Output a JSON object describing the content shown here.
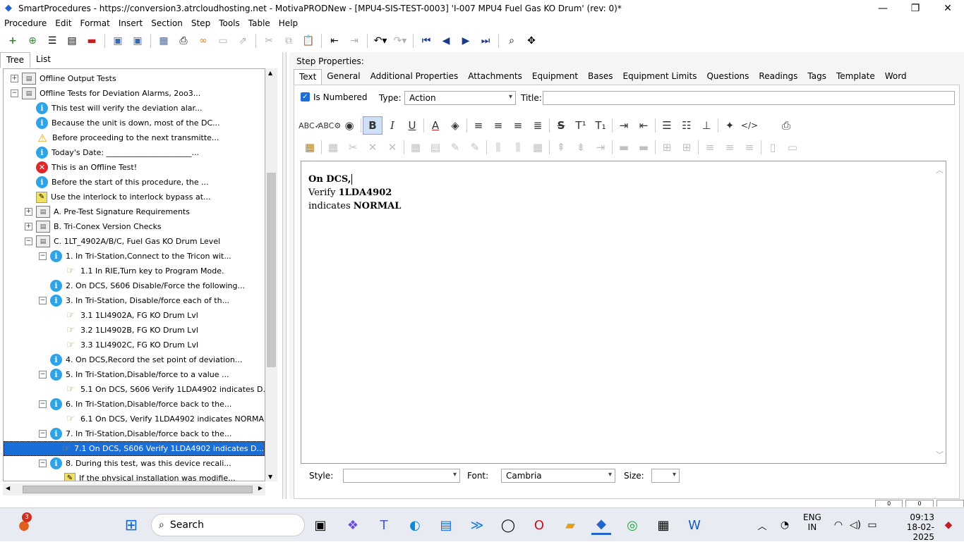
{
  "window": {
    "title": "SmartProcedures - https://conversion3.atrcloudhosting.net - MotivaPRODNew - [MPU4-SIS-TEST-0003] 'I-007 MPU4 Fuel Gas KO Drum' (rev: 0)*",
    "minimize": "—",
    "maximize": "❐",
    "close": "✕"
  },
  "menu": [
    "Procedure",
    "Edit",
    "Format",
    "Insert",
    "Section",
    "Step",
    "Tools",
    "Table",
    "Help"
  ],
  "left_tabs": [
    "Tree",
    "List"
  ],
  "tree": [
    {
      "label": "Offline Output Tests",
      "icon": "folder",
      "expander": "+"
    },
    {
      "label": "Offline Tests for Deviation Alarms, 2oo3...",
      "icon": "folder",
      "expander": "−"
    },
    {
      "label": "This test will verify the deviation alar...",
      "icon": "info"
    },
    {
      "label": "Because the unit is down, most of the DC...",
      "icon": "info"
    },
    {
      "label": "Before proceeding to the next transmitte...",
      "icon": "warning"
    },
    {
      "label": "Today's Date: ______________________...",
      "icon": "info"
    },
    {
      "label": "This is an Offline Test!",
      "icon": "error"
    },
    {
      "label": "Before the start of this procedure, the ...",
      "icon": "info"
    },
    {
      "label": "Use the interlock to interlock bypass at...",
      "icon": "note"
    },
    {
      "label": "A. Pre-Test Signature Requirements",
      "icon": "folder",
      "expander": "+"
    },
    {
      "label": "B. Tri-Conex Version Checks",
      "icon": "folder",
      "expander": "+"
    },
    {
      "label": "C. 1LT_4902A/B/C, Fuel Gas KO Drum Level",
      "icon": "folder",
      "expander": "−"
    },
    {
      "label": "1. In Tri-Station,Connect to the Tricon wit...",
      "icon": "info",
      "expander": "−"
    },
    {
      "label": "1.1 In RIE,Turn key to Program Mode.",
      "icon": "hand"
    },
    {
      "label": "2. On DCS, S606 Disable/Force the following...",
      "icon": "info"
    },
    {
      "label": "3. In Tri-Station, Disable/force each of th...",
      "icon": "info",
      "expander": "−"
    },
    {
      "label": "3.1 1LI4902A, FG KO Drum Lvl",
      "icon": "hand"
    },
    {
      "label": "3.2 1LI4902B, FG KO Drum Lvl",
      "icon": "hand"
    },
    {
      "label": "3.3 1LI4902C, FG KO Drum Lvl",
      "icon": "hand"
    },
    {
      "label": "4. On DCS,Record the set point of deviation...",
      "icon": "info"
    },
    {
      "label": "5. In Tri-Station,Disable/force to a value ...",
      "icon": "info",
      "expander": "−"
    },
    {
      "label": "5.1 On DCS, S606 Verify 1LDA4902 indicates D...",
      "icon": "hand"
    },
    {
      "label": "6. In Tri-Station,Disable/force back to the...",
      "icon": "info",
      "expander": "−"
    },
    {
      "label": "6.1 On DCS, Verify 1LDA4902  indicates NORMA...",
      "icon": "hand"
    },
    {
      "label": "7. In Tri-Station,Disable/force back to the...",
      "icon": "info",
      "expander": "−"
    },
    {
      "label": "7.1 On DCS, S606 Verify 1LDA4902 indicates D...",
      "icon": "hand",
      "selected": true
    },
    {
      "label": "8. During this test, was this device recali...",
      "icon": "info",
      "expander": "−"
    },
    {
      "label": "If the physical installation was modifie...",
      "icon": "note"
    }
  ],
  "step_properties": {
    "label": "Step Properties:",
    "tabs": [
      "Text",
      "General",
      "Additional Properties",
      "Attachments",
      "Equipment",
      "Bases",
      "Equipment Limits",
      "Questions",
      "Readings",
      "Tags",
      "Template",
      "Word"
    ],
    "is_numbered_label": "Is Numbered",
    "type_label": "Type:",
    "type_value": "Action",
    "title_label": "Title:",
    "title_value": ""
  },
  "editor": {
    "line1_bold": "On DCS,",
    "line2_prefix": "Verify ",
    "line2_bold": "1LDA4902",
    "line3_prefix": "indicates ",
    "line3_bold": "NORMAL"
  },
  "bottom": {
    "style_label": "Style:",
    "style_value": "",
    "font_label": "Font:",
    "font_value": "Cambria",
    "size_label": "Size:",
    "size_value": ""
  },
  "statusbar": [
    "0",
    "0",
    ""
  ],
  "taskbar": {
    "search_placeholder": "Search",
    "notification_count": "3",
    "lang_line1": "ENG",
    "lang_line2": "IN",
    "time": "09:13",
    "date": "18-02-2025"
  },
  "colors": {
    "accent": "#1a6ed8",
    "info": "#2da4e8",
    "error": "#e02828",
    "warning": "#f0a000"
  }
}
